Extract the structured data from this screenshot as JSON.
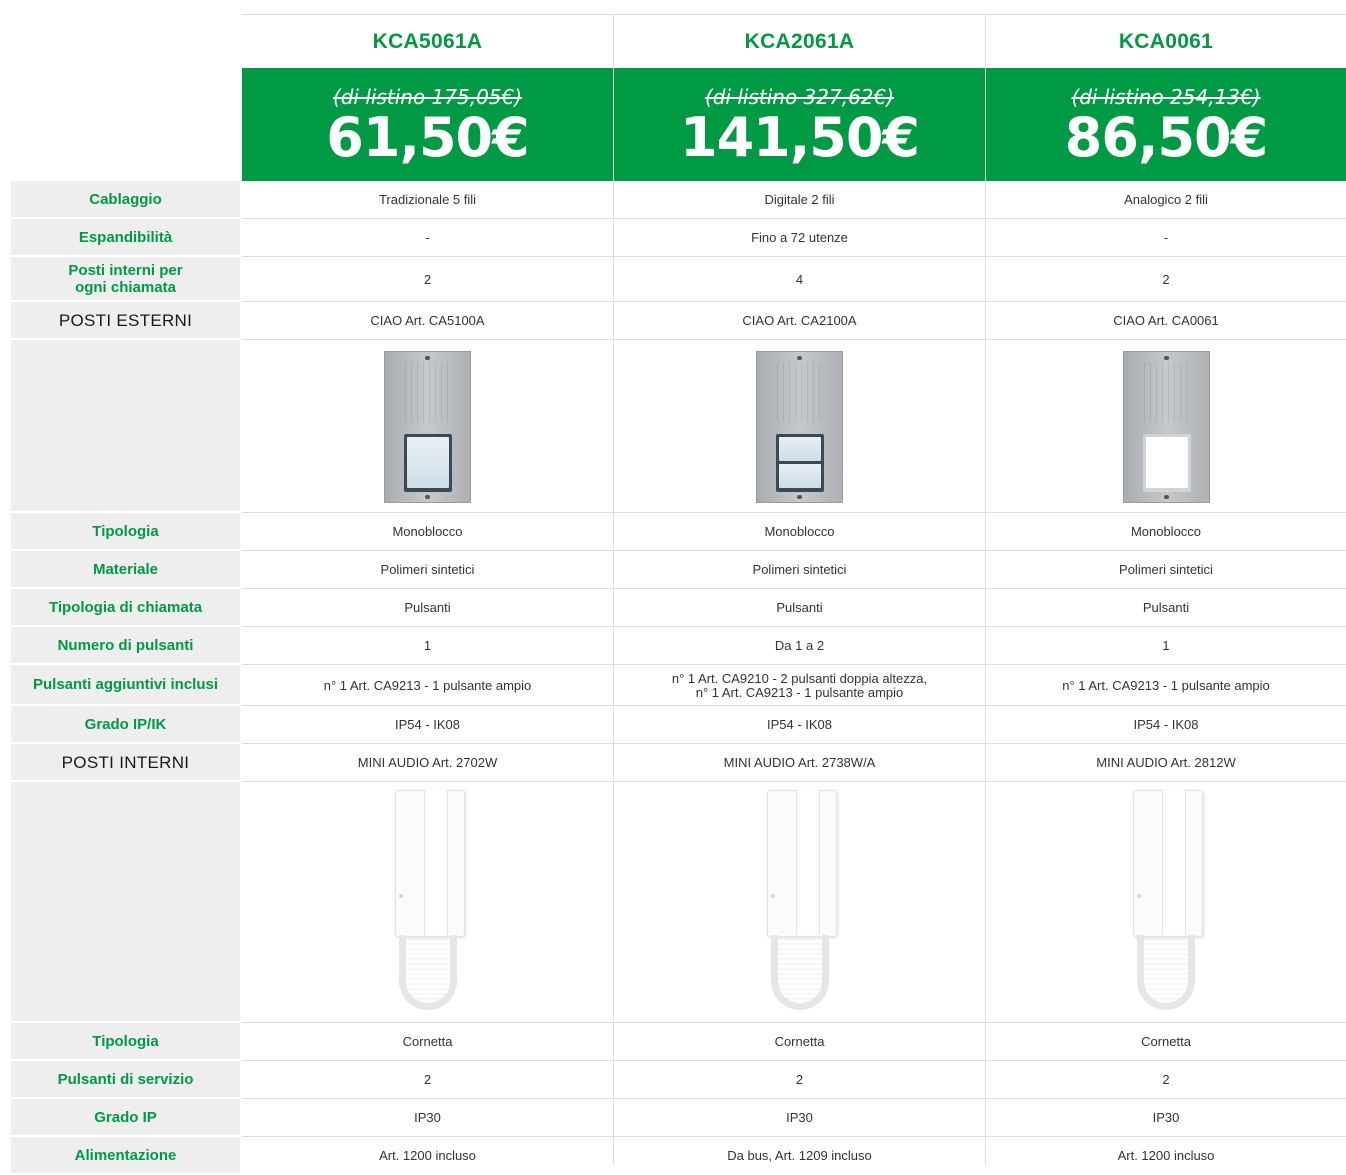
{
  "products": [
    {
      "model": "KCA5061A",
      "list_price": "(di listino 175,05€)",
      "price": "61,50€"
    },
    {
      "model": "KCA2061A",
      "list_price": "(di listino 327,62€)",
      "price": "141,50€"
    },
    {
      "model": "KCA0061",
      "list_price": "(di listino 254,13€)",
      "price": "86,50€"
    }
  ],
  "rows": {
    "cablaggio": {
      "label": "Cablaggio",
      "values": [
        "Tradizionale 5 fili",
        "Digitale 2 fili",
        "Analogico 2 fili"
      ]
    },
    "espandibilita": {
      "label": "Espandibilità",
      "values": [
        "-",
        "Fino a 72 utenze",
        "-"
      ]
    },
    "posti_interni_chiamata": {
      "label_line1": "Posti interni per",
      "label_line2": "ogni chiamata",
      "values": [
        "2",
        "4",
        "2"
      ]
    },
    "posti_esterni": {
      "label": "POSTI ESTERNI",
      "values": [
        "CIAO Art. CA5100A",
        "CIAO Art. CA2100A",
        "CIAO Art. CA0061"
      ]
    },
    "tipologia_est": {
      "label": "Tipologia",
      "values": [
        "Monoblocco",
        "Monoblocco",
        "Monoblocco"
      ]
    },
    "materiale": {
      "label": "Materiale",
      "values": [
        "Polimeri sintetici",
        "Polimeri sintetici",
        "Polimeri sintetici"
      ]
    },
    "tipologia_chiamata": {
      "label": "Tipologia di chiamata",
      "values": [
        "Pulsanti",
        "Pulsanti",
        "Pulsanti"
      ]
    },
    "numero_pulsanti": {
      "label": "Numero di pulsanti",
      "values": [
        "1",
        "Da 1 a 2",
        "1"
      ]
    },
    "pulsanti_aggiuntivi": {
      "label": "Pulsanti aggiuntivi inclusi",
      "values": [
        "n° 1 Art. CA9213 - 1 pulsante ampio",
        "n° 1 Art. CA9210 - 2 pulsanti doppia altezza,",
        "n° 1 Art. CA9213 - 1 pulsante ampio"
      ],
      "second_line": [
        "",
        "n° 1 Art. CA9213 - 1 pulsante ampio",
        ""
      ]
    },
    "grado_ipik": {
      "label": "Grado IP/IK",
      "values": [
        "IP54 - IK08",
        "IP54 - IK08",
        "IP54 - IK08"
      ]
    },
    "posti_interni": {
      "label": "POSTI INTERNI",
      "values": [
        "MINI AUDIO Art. 2702W",
        "MINI AUDIO Art. 2738W/A",
        "MINI AUDIO Art. 2812W"
      ]
    },
    "tipologia_int": {
      "label": "Tipologia",
      "values": [
        "Cornetta",
        "Cornetta",
        "Cornetta"
      ]
    },
    "pulsanti_servizio": {
      "label": "Pulsanti di servizio",
      "values": [
        "2",
        "2",
        "2"
      ]
    },
    "grado_ip": {
      "label": "Grado IP",
      "values": [
        "IP30",
        "IP30",
        "IP30"
      ]
    },
    "alimentazione": {
      "label": "Alimentazione",
      "values": [
        "Art. 1200 incluso",
        "Da bus, Art. 1209 incluso",
        "Art. 1200 incluso"
      ]
    }
  },
  "colors": {
    "accent": "#009a44",
    "label_bg": "#eeeeee"
  }
}
